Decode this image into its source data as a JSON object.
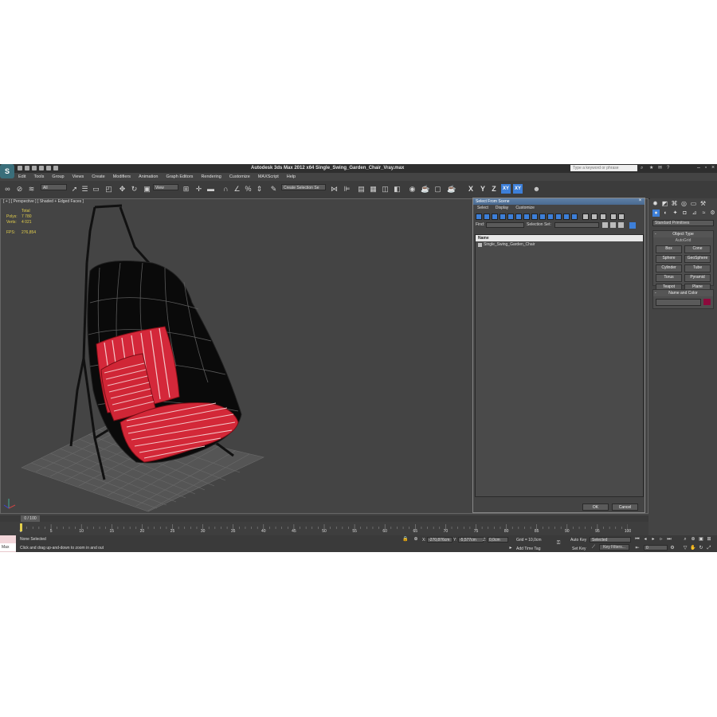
{
  "app": {
    "logo": "S",
    "title": "Autodesk 3ds Max  2012 x64     Single_Swing_Garden_Chair_Vray.max",
    "search_placeholder": "Type a keyword or phrase"
  },
  "menu": [
    "Edit",
    "Tools",
    "Group",
    "Views",
    "Create",
    "Modifiers",
    "Animation",
    "Graph Editors",
    "Rendering",
    "Customize",
    "MAXScript",
    "Help"
  ],
  "toolbar": {
    "filter_value": "All",
    "refcoord_value": "View",
    "selection_set_value": "Create Selection Se",
    "axis_x": "X",
    "axis_y": "Y",
    "axis_z": "Z",
    "axis_xy": "XY",
    "axis_xy2": "XY"
  },
  "viewport": {
    "label": "[ + ] [ Perspective ] [ Shaded + Edged Faces ]",
    "stats_total": "Total",
    "stats_polys_label": "Polys:",
    "stats_polys": "7 780",
    "stats_verts_label": "Verts:",
    "stats_verts": "4 021",
    "fps_label": "FPS:",
    "fps": "276,854"
  },
  "dialog": {
    "title": "Select From Scene",
    "menu": [
      "Select",
      "Display",
      "Customize"
    ],
    "find_label": "Find:",
    "selection_set_label": "Selection Set:",
    "column_name": "Name",
    "items": [
      "Single_Swing_Garden_Chair"
    ],
    "ok": "OK",
    "cancel": "Cancel"
  },
  "command_panel": {
    "dropdown": "Standard Primitives",
    "object_type_title": "Object Type",
    "autogrid": "AutoGrid",
    "primitives": [
      "Box",
      "Cone",
      "Sphere",
      "GeoSphere",
      "Cylinder",
      "Tube",
      "Torus",
      "Pyramid",
      "Teapot",
      "Plane"
    ],
    "name_color_title": "Name and Color",
    "color": "#8c0a3c"
  },
  "timeline": {
    "frame_label": "0 / 100",
    "ticks": [
      "0",
      "5",
      "10",
      "15",
      "20",
      "25",
      "30",
      "35",
      "40",
      "45",
      "50",
      "55",
      "60",
      "65",
      "70",
      "75",
      "80",
      "85",
      "90",
      "95",
      "100"
    ]
  },
  "status": {
    "maxscript_label": "Max",
    "selection": "None Selected",
    "prompt": "Click and drag up-and-down to zoom in and out",
    "x_label": "X:",
    "x_value": "-270,876cm",
    "y_label": "Y:",
    "y_value": "-5,577cm",
    "z_label": "Z:",
    "z_value": "0,0cm",
    "grid": "Grid = 10,0cm",
    "add_time_tag": "Add Time Tag",
    "auto_key": "Auto Key",
    "set_key": "Set Key",
    "selected_value": "Selected",
    "key_filters": "Key Filters...",
    "frame_value": "0"
  }
}
